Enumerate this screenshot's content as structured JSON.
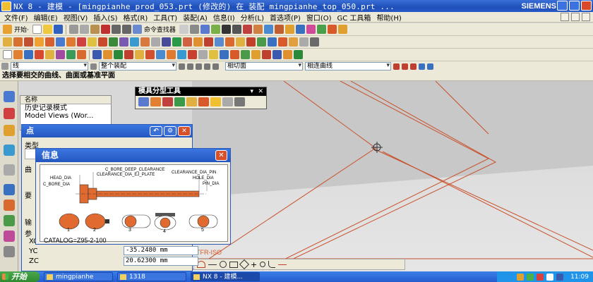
{
  "window": {
    "title": "NX 8 - 建模 - [mingpianhe_prod_053.prt  (修改的)   在 装配 mingpianhe_top_050.prt   ...",
    "brand": "SIEMENS"
  },
  "menu": [
    "文件(F)",
    "编辑(E)",
    "视图(V)",
    "插入(S)",
    "格式(R)",
    "工具(T)",
    "装配(A)",
    "信息(I)",
    "分析(L)",
    "首选项(P)",
    "窗口(O)",
    "GC 工具箱",
    "帮助(H)"
  ],
  "toolbar": {
    "start_label": "开始·",
    "command_finder_label": "命令查找器"
  },
  "selection_bar": {
    "filter": "线",
    "scope": "整个装配",
    "intent1": "相切面",
    "intent2": "相连曲线"
  },
  "cue_line": "选择要相交的曲线、曲面或基准平面",
  "navigator": {
    "column_header": "名称",
    "rows": [
      "历史记录模式",
      "Model Views (Wor..."
    ]
  },
  "palette": {
    "title": "模具分型工具"
  },
  "point_dialog": {
    "title": "点",
    "section_type": "类型",
    "section_point_location": "曲",
    "section_output": "要",
    "section_offset": "输",
    "section_params": "参",
    "coord_labels": [
      "XC",
      "YC",
      "ZC"
    ],
    "coord_values": [
      "",
      "-35.2480 mm",
      "20.62300 mm"
    ]
  },
  "info_dialog": {
    "title": "信息",
    "labels": {
      "head_dia": "HEAD_DIA",
      "c_bore_dia": "C_BORE_DIA",
      "c_bore_deep_clearance": "C_BORE_DEEP_CLEARANCE",
      "clearance_dia_ej_plate": "CLEARANCE_DIA_EJ_PLATE",
      "clearance_dia_pin": "CLEARANCE_DIA_PIN",
      "hole_dia": "HOLE_DIA",
      "pin_dia": "PIN_DIA"
    },
    "section_numbers": [
      "1",
      "2",
      "3",
      "4",
      "5"
    ],
    "catalog": "CATALOG=Z95-2-100"
  },
  "graphics": {
    "watermark": "TFR-ISO"
  },
  "taskbar": {
    "start_label": "开始",
    "tasks": [
      "mingpianhe",
      "1318",
      "NX 8 - 建模..."
    ],
    "clock": "11:09"
  },
  "colors": {
    "accent": "#d85a2a",
    "titlebar": "#2457c0",
    "chrome": "#ece9d8"
  }
}
